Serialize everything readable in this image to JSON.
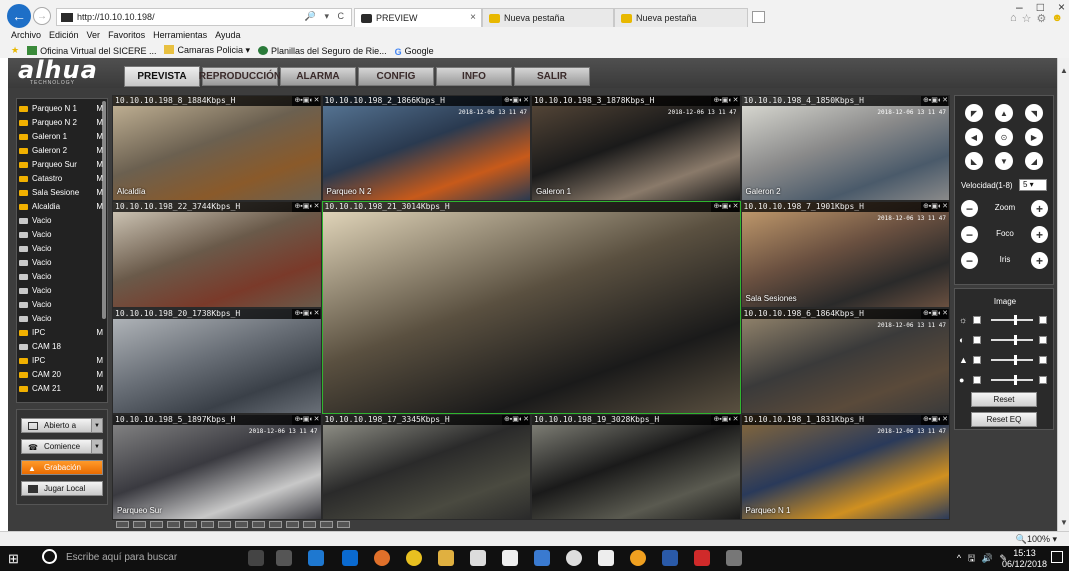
{
  "browser": {
    "url": "http://10.10.10.198/",
    "address_controls": "🔎 ▾ C",
    "tabs": [
      {
        "title": "PREVIEW",
        "active": true
      },
      {
        "title": "Nueva pestaña",
        "active": false
      },
      {
        "title": "Nueva pestaña",
        "active": false
      }
    ],
    "menu": [
      "Archivo",
      "Edición",
      "Ver",
      "Favoritos",
      "Herramientas",
      "Ayuda"
    ],
    "favorites": [
      "Oficina Virtual del SICERE ...",
      "Camaras Policia ▾",
      "Planillas del Seguro de Rie...",
      "Google"
    ],
    "window_controls": [
      "–",
      "□",
      "×"
    ]
  },
  "app": {
    "logo": "alhua",
    "logo_sub": "TECHNOLOGY",
    "main_tabs": [
      "PREVISTA",
      "REPRODUCCIÓN",
      "ALARMA",
      "CONFIG",
      "INFO",
      "SALIR"
    ],
    "active_tab": 0
  },
  "channels": [
    {
      "name": "Parqueo N 1",
      "flag": "M",
      "active": true
    },
    {
      "name": "Parqueo N 2",
      "flag": "M",
      "active": true
    },
    {
      "name": "Galeron 1",
      "flag": "M",
      "active": true
    },
    {
      "name": "Galeron 2",
      "flag": "M",
      "active": true
    },
    {
      "name": "Parqueo Sur",
      "flag": "M",
      "active": true
    },
    {
      "name": "Catastro",
      "flag": "M",
      "active": true
    },
    {
      "name": "Sala Sesione",
      "flag": "M",
      "active": true
    },
    {
      "name": "Alcaldia",
      "flag": "M",
      "active": true
    },
    {
      "name": "Vacio",
      "flag": "",
      "active": false
    },
    {
      "name": "Vacio",
      "flag": "",
      "active": false
    },
    {
      "name": "Vacio",
      "flag": "",
      "active": false
    },
    {
      "name": "Vacio",
      "flag": "",
      "active": false
    },
    {
      "name": "Vacio",
      "flag": "",
      "active": false
    },
    {
      "name": "Vacio",
      "flag": "",
      "active": false
    },
    {
      "name": "Vacio",
      "flag": "",
      "active": false
    },
    {
      "name": "Vacio",
      "flag": "",
      "active": false
    },
    {
      "name": "IPC",
      "flag": "M",
      "active": true
    },
    {
      "name": "CAM 18",
      "flag": "",
      "active": false
    },
    {
      "name": "IPC",
      "flag": "M",
      "active": true
    },
    {
      "name": "CAM 20",
      "flag": "M",
      "active": true
    },
    {
      "name": "CAM 21",
      "flag": "M",
      "active": true
    }
  ],
  "left_buttons": {
    "open_all": "Abierto a",
    "talk": "Comience",
    "record": "Grabación",
    "play_local": "Jugar Local"
  },
  "cameras": [
    {
      "header": "10.10.10.198_8_1884Kbps_H",
      "label": "Alcaldía",
      "osd": "",
      "colors": [
        "#6b6050",
        "#c8b89a",
        "#8a5a2a"
      ]
    },
    {
      "header": "10.10.10.198_2_1866Kbps_H",
      "label": "Parqueo N 2",
      "osd": "2018-12-06 13 11 47",
      "colors": [
        "#2a3a50",
        "#5a7a9a",
        "#c85a1a"
      ]
    },
    {
      "header": "10.10.10.198_3_1878Kbps_H",
      "label": "Galeron 1",
      "osd": "2018-12-06 13 11 47",
      "colors": [
        "#1a1a1a",
        "#5a4a3a",
        "#8a7a6a"
      ]
    },
    {
      "header": "10.10.10.198_4_1850Kbps_H",
      "label": "Galeron 2",
      "osd": "2018-12-06 13 11 47",
      "colors": [
        "#8a8a8a",
        "#e0e0d8",
        "#4a5a6a"
      ]
    },
    {
      "header": "10.10.10.198_22_3744Kbps_H",
      "label": "",
      "osd": "",
      "colors": [
        "#6a5a4a",
        "#d8d0c0",
        "#7a3a2a"
      ]
    },
    {
      "header": "10.10.10.198_21_3014Kbps_H",
      "label": "",
      "osd": "",
      "colors": [
        "#5a5040",
        "#e8dcc0",
        "#1a1a1a"
      ]
    },
    {
      "header": "10.10.10.198_7_1901Kbps_H",
      "label": "Sala Sesiones",
      "osd": "2018-12-06 13 11 47",
      "colors": [
        "#6a5040",
        "#c8a070",
        "#2a2a2a"
      ]
    },
    {
      "header": "10.10.10.198_20_1738Kbps_H",
      "label": "",
      "osd": "",
      "colors": [
        "#6a7078",
        "#b8bcc0",
        "#3a4048"
      ]
    },
    {
      "header": "10.10.10.198_6_1864Kbps_H",
      "label": "",
      "osd": "2018-12-06 13 11 47",
      "colors": [
        "#3a3a3a",
        "#9a8a70",
        "#5a4a3a"
      ]
    },
    {
      "header": "10.10.10.198_5_1897Kbps_H",
      "label": "Parqueo Sur",
      "osd": "2018-12-06 13 11 47",
      "colors": [
        "#3a3a40",
        "#8a8a8a",
        "#c8c8c8"
      ]
    },
    {
      "header": "10.10.10.198_17_3345Kbps_H",
      "label": "",
      "osd": "",
      "colors": [
        "#2a2a2a",
        "#9a9a90",
        "#4a4a40"
      ]
    },
    {
      "header": "10.10.10.198_19_3028Kbps_H",
      "label": "",
      "osd": "",
      "colors": [
        "#1a1a1a",
        "#8a8a80",
        "#5a5a50"
      ]
    },
    {
      "header": "10.10.10.198_1_1831Kbps_H",
      "label": "Parqueo N 1",
      "osd": "2018-12-06 13 11 47",
      "colors": [
        "#2a3a5a",
        "#8a6a3a",
        "#d09020"
      ]
    }
  ],
  "camera_header_icons": "⊕▪▣◐✕",
  "ptz": {
    "arrows": [
      "◤",
      "▲",
      "◥",
      "◀",
      "⊙",
      "▶",
      "◣",
      "▼",
      "◢"
    ],
    "speed_label": "Velocidad(1-8)",
    "speed_value": "5 ▾",
    "zoom_label": "Zoom",
    "focus_label": "Foco",
    "iris_label": "Iris",
    "minus": "−",
    "plus": "+"
  },
  "image": {
    "title": "Image",
    "slider_icons": [
      "☼",
      "◐",
      "▲",
      "●"
    ],
    "reset": "Reset",
    "reset_eq": "Reset EQ"
  },
  "status": {
    "zoom": "🔍100% ▾"
  },
  "taskbar": {
    "search_placeholder": "Escribe aquí para buscar",
    "tray": "^ 🖫 🔊 ✎",
    "time": "15:13",
    "date": "06/12/2018"
  }
}
